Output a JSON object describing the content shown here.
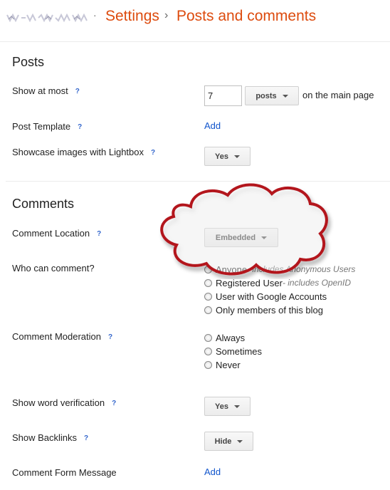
{
  "breadcrumb": {
    "separator": "·",
    "settings": "Settings",
    "arrow": "›",
    "page": "Posts and comments"
  },
  "posts": {
    "title": "Posts",
    "show_at_most": {
      "label": "Show at most",
      "help": "?",
      "value": "7",
      "unit": "posts",
      "suffix": "on the main page"
    },
    "post_template": {
      "label": "Post Template",
      "help": "?",
      "action": "Add"
    },
    "lightbox": {
      "label": "Showcase images with Lightbox",
      "help": "?",
      "value": "Yes"
    }
  },
  "comments": {
    "title": "Comments",
    "location": {
      "label": "Comment Location",
      "help": "?",
      "value": "Embedded"
    },
    "who": {
      "label": "Who can comment?",
      "options": [
        {
          "label": "Anyone",
          "hint": " - includes Anonymous Users"
        },
        {
          "label": "Registered User",
          "hint": " - includes OpenID"
        },
        {
          "label": "User with Google Accounts",
          "hint": ""
        },
        {
          "label": "Only members of this blog",
          "hint": ""
        }
      ]
    },
    "moderation": {
      "label": "Comment Moderation",
      "help": "?",
      "options": [
        "Always",
        "Sometimes",
        "Never"
      ]
    },
    "word_verification": {
      "label": "Show word verification",
      "help": "?",
      "value": "Yes"
    },
    "backlinks": {
      "label": "Show Backlinks",
      "help": "?",
      "value": "Hide"
    },
    "form_message": {
      "label": "Comment Form Message",
      "action": "Add"
    }
  },
  "colors": {
    "accent": "#dd4b0e",
    "link": "#1155cc",
    "cloud": "#b3121f"
  }
}
